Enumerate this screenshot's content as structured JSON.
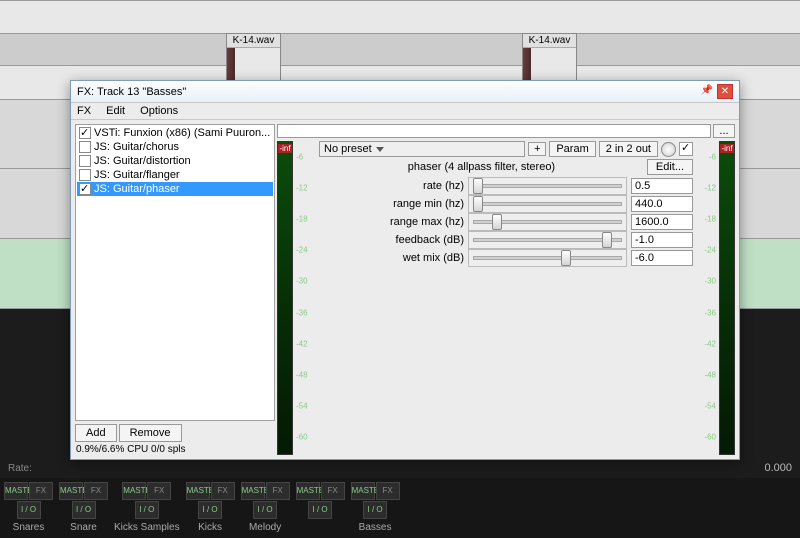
{
  "clips": {
    "a": "K-14.wav",
    "b": "K-14.wav"
  },
  "transport": {
    "rate_label": "Rate:",
    "time": "0.000"
  },
  "mixer_tracks": [
    {
      "name": "Snares"
    },
    {
      "name": "Snare"
    },
    {
      "name": "Kicks Samples"
    },
    {
      "name": "Kicks"
    },
    {
      "name": "Melody"
    },
    {
      "name": ""
    },
    {
      "name": "Basses"
    }
  ],
  "mixer_btn1": "MASTER",
  "mixer_btn2": "I / O",
  "mixer_fx": "FX",
  "fxwin": {
    "title": "FX: Track 13 \"Basses\"",
    "menu": [
      "FX",
      "Edit",
      "Options"
    ],
    "list": [
      {
        "on": true,
        "label": "VSTi: Funxion (x86) (Sami Puuron..."
      },
      {
        "on": false,
        "label": "JS: Guitar/chorus"
      },
      {
        "on": false,
        "label": "JS: Guitar/distortion"
      },
      {
        "on": false,
        "label": "JS: Guitar/flanger"
      },
      {
        "on": true,
        "label": "JS: Guitar/phaser",
        "sel": true
      }
    ],
    "add": "Add",
    "remove": "Remove",
    "cpu": "0.9%/6.6% CPU 0/0 spls",
    "preset_label": "No preset",
    "param_btn": "Param",
    "routing": "2 in 2 out",
    "desc": "phaser (4 allpass filter, stereo)",
    "edit": "Edit...",
    "meter_inf": "-inf",
    "meter_ticks": [
      "-6",
      "-12",
      "-18",
      "-24",
      "-30",
      "-36",
      "-42",
      "-48",
      "-54",
      "-60"
    ],
    "params": [
      {
        "label": "rate (hz)",
        "value": "0.5",
        "pos": 6
      },
      {
        "label": "range min (hz)",
        "value": "440.0",
        "pos": 6
      },
      {
        "label": "range max (hz)",
        "value": "1600.0",
        "pos": 18
      },
      {
        "label": "feedback (dB)",
        "value": "-1.0",
        "pos": 88
      },
      {
        "label": "wet mix (dB)",
        "value": "-6.0",
        "pos": 62
      }
    ]
  }
}
